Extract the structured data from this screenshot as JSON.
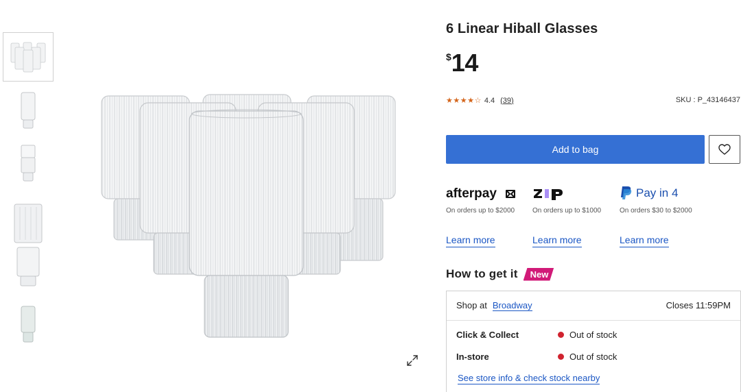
{
  "product": {
    "title": "6 Linear Hiball Glasses",
    "currency": "$",
    "price": "14",
    "rating": {
      "stars": "★★★★☆",
      "value": "4.4",
      "count": "(39)"
    },
    "sku": "SKU : P_43146437"
  },
  "gallery": {
    "thumbnails": [
      "six-glasses-group",
      "single-glass",
      "single-glass-short",
      "single-glass-tall",
      "glass-side",
      "glass-frosted"
    ],
    "expand_icon": "expand-icon"
  },
  "actions": {
    "add_to_bag": "Add to bag",
    "wishlist_icon": "heart-icon"
  },
  "payments": [
    {
      "name": "afterpay",
      "logo": "afterpay",
      "note": "On orders up to $2000",
      "link": "Learn more"
    },
    {
      "name": "zip",
      "logo": "zip",
      "note": "On orders up to $1000",
      "link": "Learn more"
    },
    {
      "name": "paypal",
      "logo": "Pay in 4",
      "note": "On orders $30 to $2000",
      "link": "Learn more"
    }
  ],
  "fulfilment": {
    "heading": "How to get it",
    "badge": "New",
    "shop_at": "Shop at",
    "store": "Broadway",
    "closes": "Closes 11:59PM",
    "rows": [
      {
        "label": "Click & Collect",
        "status": "Out of stock"
      },
      {
        "label": "In-store",
        "status": "Out of stock"
      }
    ],
    "store_link": "See store info & check stock nearby"
  },
  "colors": {
    "primary": "#3570d4",
    "link": "#1a56c4",
    "star": "#d4651b",
    "badge": "#d11a78",
    "out_of_stock": "#d0232f"
  }
}
